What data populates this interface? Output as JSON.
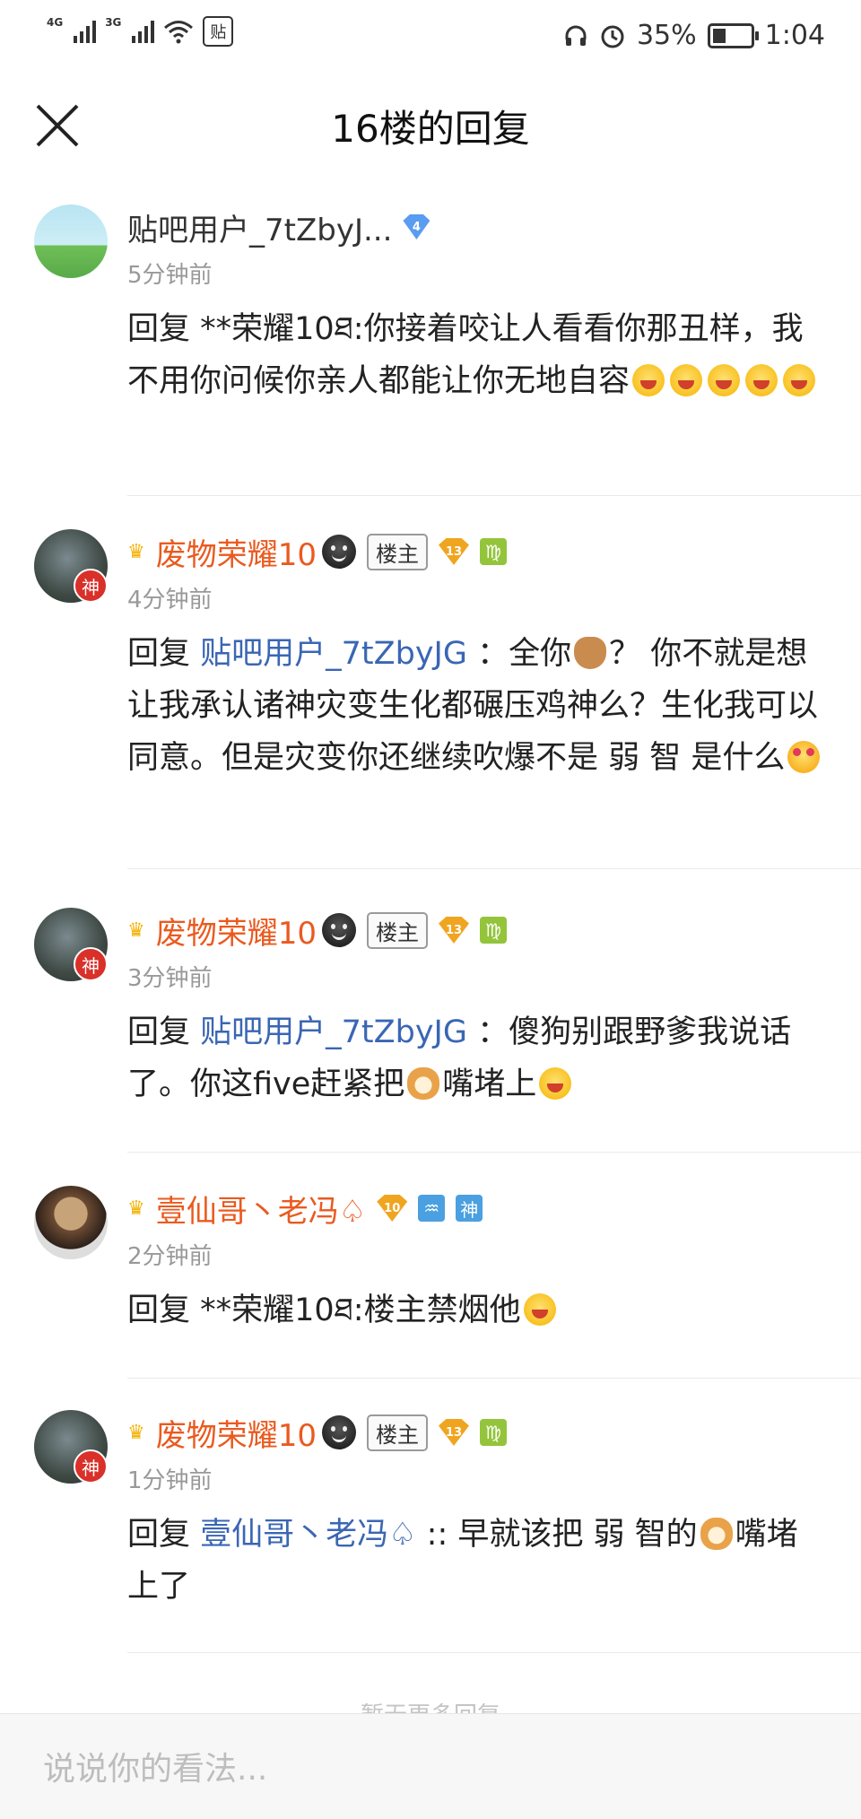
{
  "status_bar": {
    "net1": "4G",
    "net2": "3G",
    "tie_icon": "贴",
    "battery": "35%",
    "battery_fraction": 0.35,
    "time": "1:04"
  },
  "header": {
    "title": "16楼的回复"
  },
  "replies": [
    {
      "username": "贴吧用户_7tZbyJ...",
      "badge_level": "4",
      "time": "5分钟前",
      "text_1": "回复 **荣耀10ཐ:你接着咬让人看看你那丑样，我不用你问候你亲人都能让你无地自容"
    },
    {
      "username": "废物荣耀10",
      "owner_badge": "楼主",
      "badge_level": "13",
      "zodiac": "♍",
      "avatar_badge": "神",
      "time": "4分钟前",
      "prefix": "回复 ",
      "link": "贴吧用户_7tZbyJG",
      "text_1": " ：全你",
      "text_2": "？ 你不就是想让我承认诸神灾变生化都碾压鸡神么？生化我可以同意。但是灾变你还继续吹爆不是 弱 智 是什么"
    },
    {
      "username": "废物荣耀10",
      "owner_badge": "楼主",
      "badge_level": "13",
      "zodiac": "♍",
      "avatar_badge": "神",
      "time": "3分钟前",
      "prefix": "回复 ",
      "link": "贴吧用户_7tZbyJG",
      "text_1": " ：傻狗别跟野爹我说话了。你这five赶紧把",
      "text_2": "嘴堵上"
    },
    {
      "username": "壹仙哥丶老冯♤",
      "badge_level": "10",
      "zodiac": "♒",
      "extra_icon": "神",
      "time": "2分钟前",
      "text_1": "回复 **荣耀10ཐ:楼主禁烟他"
    },
    {
      "username": "废物荣耀10",
      "owner_badge": "楼主",
      "badge_level": "13",
      "zodiac": "♍",
      "avatar_badge": "神",
      "time": "1分钟前",
      "prefix": "回复 ",
      "link": "壹仙哥丶老冯♤",
      "text_1": " :: 早就该把 弱 智的",
      "text_2": "嘴堵上了"
    }
  ],
  "more_hint": "暂无更多回复",
  "input": {
    "placeholder": "说说你的看法..."
  }
}
